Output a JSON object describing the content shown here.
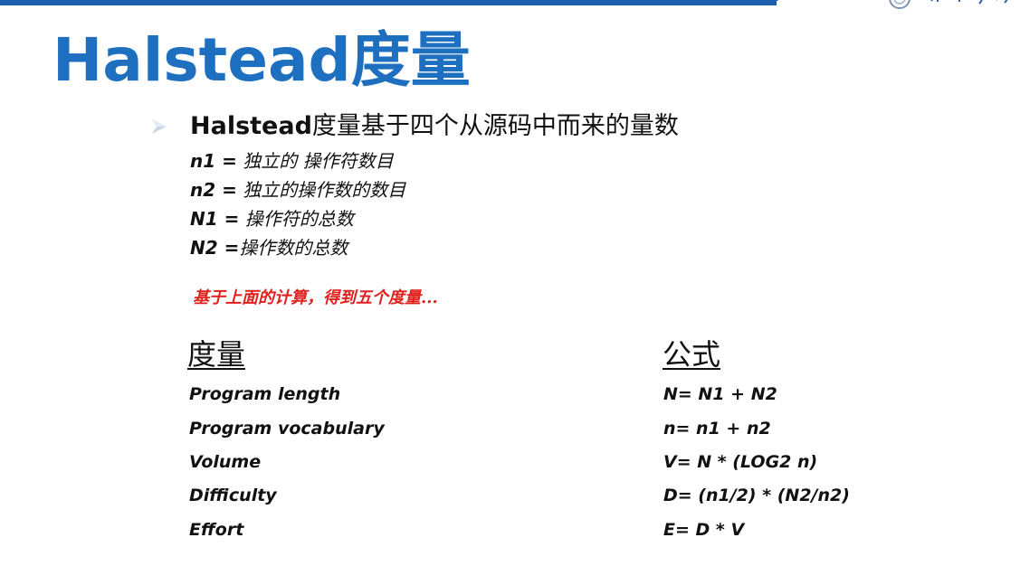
{
  "slide": {
    "title": "Halstead度量",
    "bullet": {
      "lead": "Halstead",
      "rest": "度量基于四个从源码中而来的量数"
    },
    "definitions": [
      {
        "var": "n1 =",
        "desc": " 独立的 操作符数目"
      },
      {
        "var": "n2 =",
        "desc": " 独立的操作数的数目"
      },
      {
        "var": "N1 =",
        "desc": " 操作符的总数"
      },
      {
        "var": "N2 =",
        "desc": "操作数的总数"
      }
    ],
    "note": "基于上面的计算，得到五个度量...",
    "table": {
      "header_metric": "度量",
      "header_formula": "公式",
      "rows": [
        {
          "metric": "Program length",
          "formula": "N= N1 + N2"
        },
        {
          "metric": "Program vocabulary",
          "formula": "n= n1 + n2"
        },
        {
          "metric": "Volume",
          "formula": "V= N * (LOG2 n)"
        },
        {
          "metric": "Difficulty",
          "formula": "D= (n1/2) * (N2/n2)"
        },
        {
          "metric": "Effort",
          "formula": "E= D * V"
        }
      ]
    }
  },
  "colors": {
    "title": "#1e6fc0",
    "top_bar": "#1f5fae",
    "note": "#e0201c",
    "text": "#111111"
  }
}
